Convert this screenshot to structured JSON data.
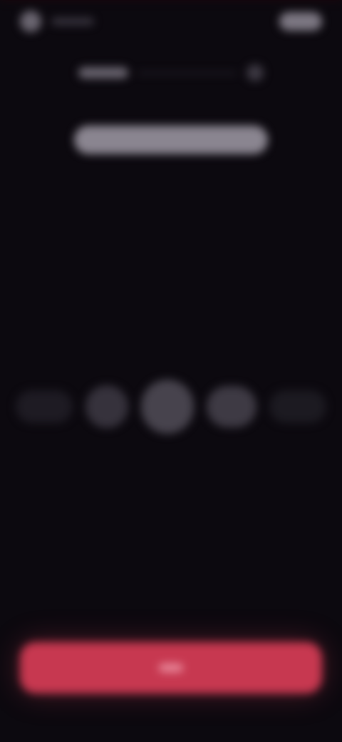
{
  "theme": {
    "background": "#0c090f",
    "accent": "#c73850"
  },
  "status_bar": {
    "left_icon": "status-icon",
    "right_icon": "battery-icon"
  },
  "header": {
    "title": "",
    "action_icon": "menu-icon"
  },
  "headline": {
    "text": ""
  },
  "segments": {
    "items": [
      {
        "label": ""
      },
      {
        "label": ""
      },
      {
        "label": ""
      },
      {
        "label": ""
      },
      {
        "label": ""
      }
    ]
  },
  "primary_button": {
    "label": ""
  }
}
